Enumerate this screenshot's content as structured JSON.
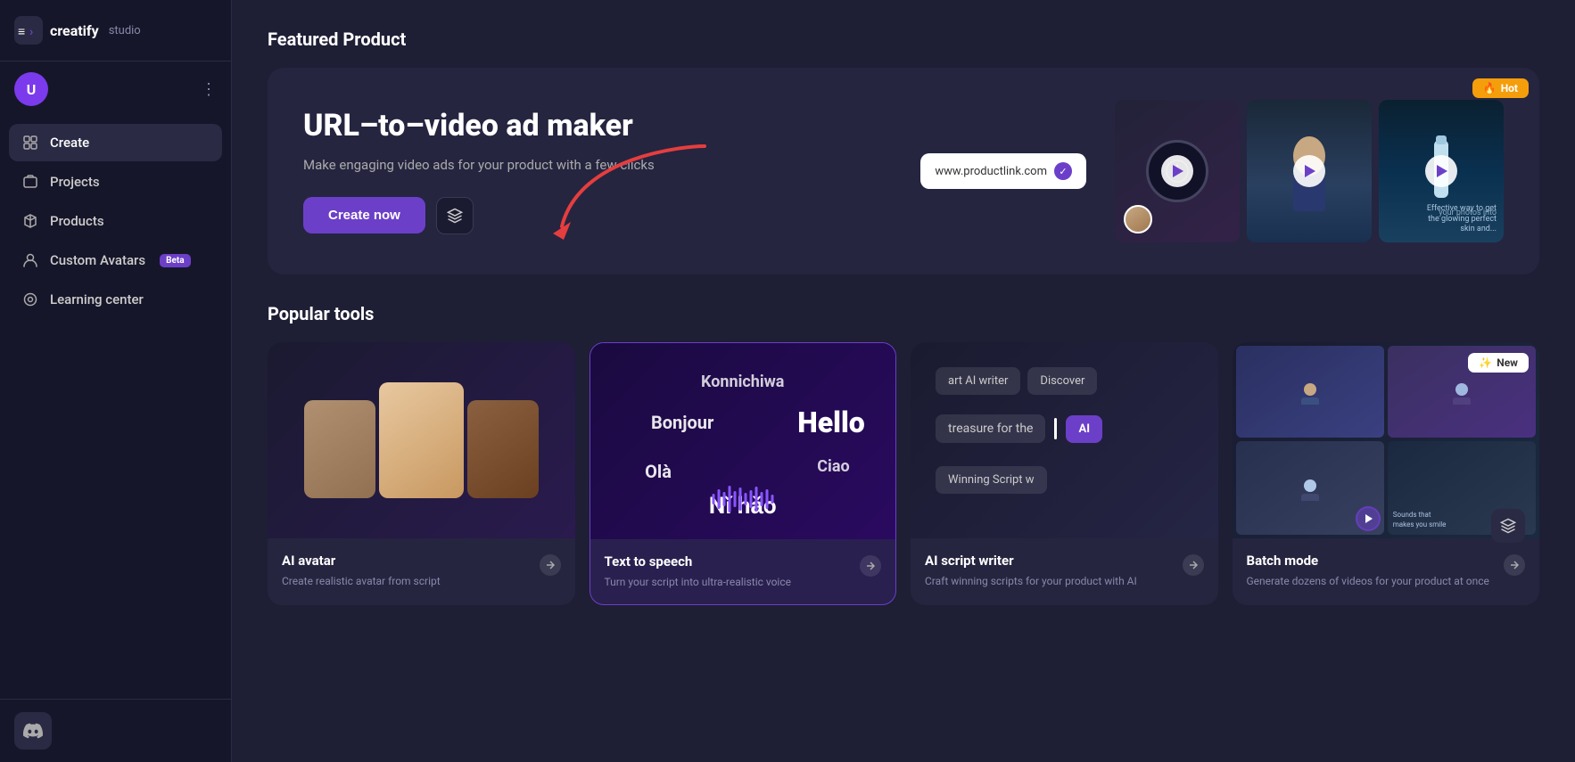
{
  "app": {
    "logo_text": "creatify",
    "logo_studio": "studio",
    "logo_icon": "≡>"
  },
  "sidebar": {
    "user_initial": "U",
    "nav_items": [
      {
        "id": "create",
        "label": "Create",
        "icon": "create-icon",
        "active": true
      },
      {
        "id": "projects",
        "label": "Projects",
        "icon": "projects-icon",
        "active": false
      },
      {
        "id": "products",
        "label": "Products",
        "icon": "products-icon",
        "active": false
      },
      {
        "id": "custom-avatars",
        "label": "Custom Avatars",
        "icon": "avatar-icon",
        "active": false,
        "badge": "Beta"
      },
      {
        "id": "learning-center",
        "label": "Learning center",
        "icon": "learning-icon",
        "active": false
      }
    ]
  },
  "featured": {
    "section_title": "Featured Product",
    "card_title": "URL–to–video ad maker",
    "card_subtitle": "Make engaging video ads for your product with a few clicks",
    "create_btn": "Create now",
    "url_placeholder": "www.productlink.com",
    "hot_label": "Hot"
  },
  "popular_tools": {
    "section_title": "Popular tools",
    "new_label": "New",
    "tools": [
      {
        "id": "ai-avatar",
        "name": "AI avatar",
        "desc": "Create realistic avatar from script",
        "visual_type": "avatar"
      },
      {
        "id": "text-to-speech",
        "name": "Text to speech",
        "desc": "Turn your script into ultra-realistic voice",
        "visual_type": "tts",
        "highlighted": true,
        "words": [
          "Konnichiwa",
          "Bonjour",
          "Hello",
          "Olà",
          "Ciao",
          "Nǐ hǎo"
        ]
      },
      {
        "id": "ai-script-writer",
        "name": "AI script writer",
        "desc": "Craft winning scripts for your product with AI",
        "visual_type": "ai-script",
        "chips": [
          "art AI writer",
          "Discover",
          "treasure for the",
          "AI",
          "Winning Script w"
        ]
      },
      {
        "id": "batch-mode",
        "name": "Batch mode",
        "desc": "Generate dozens of videos for your product at once",
        "visual_type": "batch"
      }
    ]
  }
}
